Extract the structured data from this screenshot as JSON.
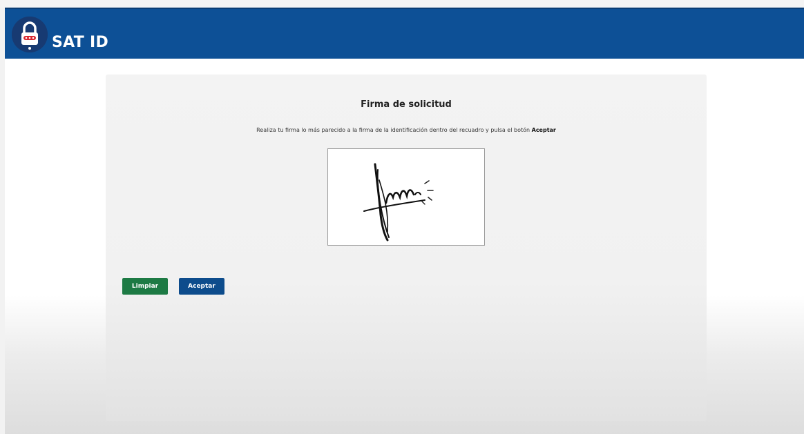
{
  "header": {
    "title": "SAT ID",
    "logo_icon": "padlock-icon",
    "bg_color": "#0d5096"
  },
  "panel": {
    "title": "Firma de solicitud",
    "instruction_text": "Realiza tu firma lo más parecido a la firma de la identificación dentro del recuadro y pulsa el botón",
    "instruction_emphasis": "Aceptar"
  },
  "signature_pad": {
    "has_signature": true
  },
  "buttons": {
    "clear_label": "Limpiar",
    "clear_color": "#1d7a44",
    "accept_label": "Aceptar",
    "accept_color": "#0d4c8c"
  }
}
